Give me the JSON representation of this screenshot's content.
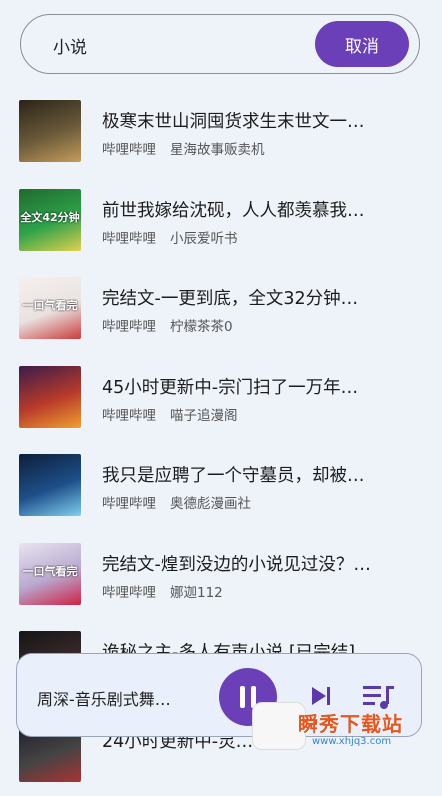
{
  "search": {
    "query": "小说",
    "cancel_label": "取消"
  },
  "results": [
    {
      "title": "极寒末世山洞囤货求生末世文一…",
      "source": "哔哩哔哩",
      "uploader": "星海故事贩卖机",
      "thumb_caption": "",
      "thumb_colors": [
        "#2a2418",
        "#6b5a3a",
        "#c59d5a"
      ]
    },
    {
      "title": "前世我嫁给沈砚，人人都羡慕我…",
      "source": "哔哩哔哩",
      "uploader": "小辰爱听书",
      "thumb_caption": "全文42分钟",
      "thumb_colors": [
        "#1f6b2e",
        "#2fa24a",
        "#e0d050"
      ]
    },
    {
      "title": "完结文-一更到底，全文32分钟…",
      "source": "哔哩哔哩",
      "uploader": "柠檬茶茶0",
      "thumb_caption": "一口气看完",
      "thumb_colors": [
        "#f5f0ee",
        "#e9e2e0",
        "#c93c3c"
      ]
    },
    {
      "title": "45小时更新中-宗门扫了一万年…",
      "source": "哔哩哔哩",
      "uploader": "喵子追漫阁",
      "thumb_caption": "",
      "thumb_colors": [
        "#3a1c4a",
        "#b83a2a",
        "#f0a030"
      ]
    },
    {
      "title": "我只是应聘了一个守墓员，却被…",
      "source": "哔哩哔哩",
      "uploader": "奥德彪漫画社",
      "thumb_caption": "",
      "thumb_colors": [
        "#0c1f3a",
        "#1e4f8a",
        "#7fd0f0"
      ]
    },
    {
      "title": "完结文-煌到没边的小说见过没？…",
      "source": "哔哩哔哩",
      "uploader": "娜迦112",
      "thumb_caption": "一口气看完",
      "thumb_colors": [
        "#e8e4ef",
        "#b9a9d0",
        "#cc2244"
      ]
    },
    {
      "title": "诡秘之主-多人有声小说 [已完结]",
      "source": "",
      "uploader": "",
      "thumb_caption": "",
      "thumb_colors": [
        "#151515",
        "#3a2a2a",
        "#902020"
      ]
    },
    {
      "title": "24小时更新中-灵…",
      "source": "",
      "uploader": "",
      "thumb_caption": "",
      "thumb_colors": [
        "#1a1a2a",
        "#444",
        "#aa3333"
      ]
    }
  ],
  "player": {
    "track": "周深-音乐剧式舞…"
  },
  "watermark": {
    "text": "瞬秀下载站",
    "url": "www.xhjq3.com"
  },
  "colors": {
    "accent": "#6a3fb8",
    "background": "#eef3fa"
  }
}
